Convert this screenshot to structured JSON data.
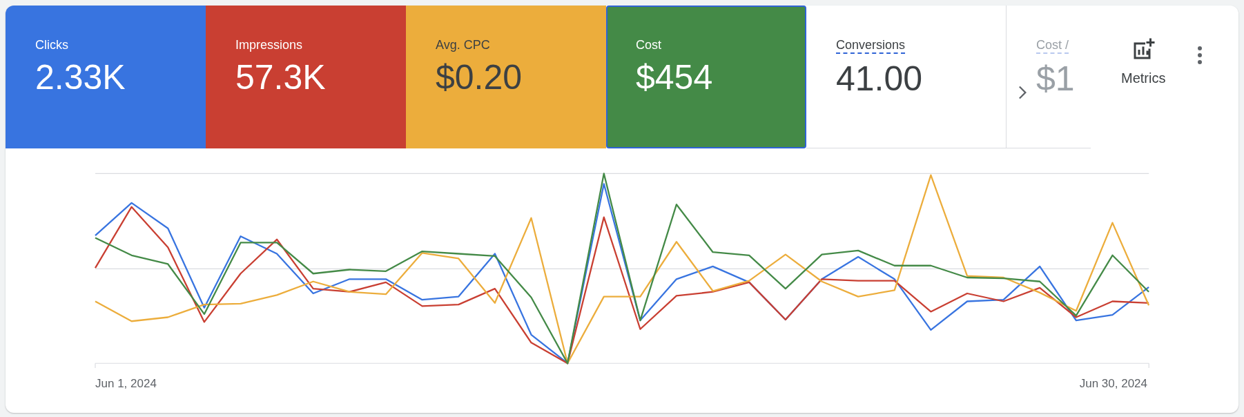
{
  "metrics": [
    {
      "kind": "tile",
      "label": "Clicks",
      "value": "2.33K",
      "selected": true,
      "focused": false,
      "color": "#3874e0"
    },
    {
      "kind": "tile",
      "label": "Impressions",
      "value": "57.3K",
      "selected": true,
      "focused": false,
      "color": "#c93f32"
    },
    {
      "kind": "tile",
      "label": "Avg. CPC",
      "value": "$0.20",
      "selected": true,
      "focused": false,
      "color": "#ecad3c"
    },
    {
      "kind": "tile",
      "label": "Cost",
      "value": "$454",
      "selected": true,
      "focused": true,
      "color": "#448a47"
    },
    {
      "kind": "tile",
      "label": "Conversions",
      "value": "41.00",
      "selected": false,
      "focused": false
    },
    {
      "kind": "faded",
      "label": "Cost /",
      "value": "$1",
      "selected": false,
      "focused": false
    }
  ],
  "metrics_button": {
    "label": "Metrics"
  },
  "chart": {
    "x_start": "Jun 1, 2024",
    "x_end": "Jun 30, 2024"
  }
}
